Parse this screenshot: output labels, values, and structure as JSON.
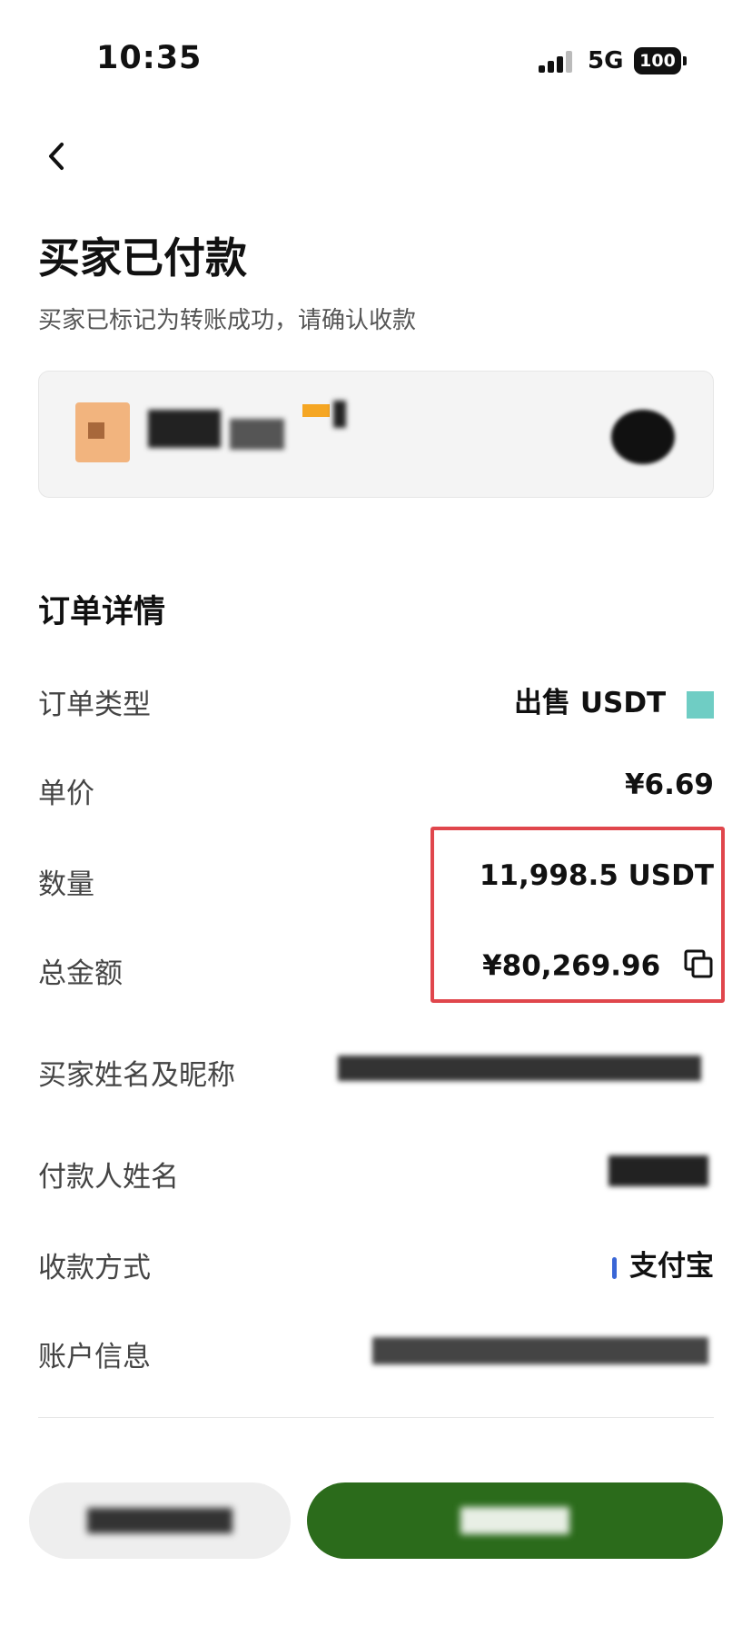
{
  "status_bar": {
    "time": "10:35",
    "network": "5G",
    "battery": "100"
  },
  "header": {
    "title": "买家已付款",
    "subtitle": "买家已标记为转账成功，请确认收款"
  },
  "counterparty": {
    "name": "",
    "icon": "avatar-icon"
  },
  "order_details": {
    "section_title": "订单详情",
    "rows": [
      {
        "label": "订单类型",
        "value": "出售 USDT"
      },
      {
        "label": "单价",
        "value": "¥6.69"
      },
      {
        "label": "数量",
        "value": "11,998.5 USDT"
      },
      {
        "label": "总金额",
        "value": "¥80,269.96"
      },
      {
        "label": "买家姓名及昵称",
        "value": ""
      },
      {
        "label": "付款人姓名",
        "value": ""
      },
      {
        "label": "收款方式",
        "value": "支付宝"
      },
      {
        "label": "账户信息",
        "value": ""
      }
    ]
  },
  "actions": {
    "secondary_label": "",
    "primary_label": ""
  },
  "colors": {
    "primary": "#2b6b1b",
    "highlight": "#e0464c",
    "alipay_accent": "#3a66d6"
  }
}
